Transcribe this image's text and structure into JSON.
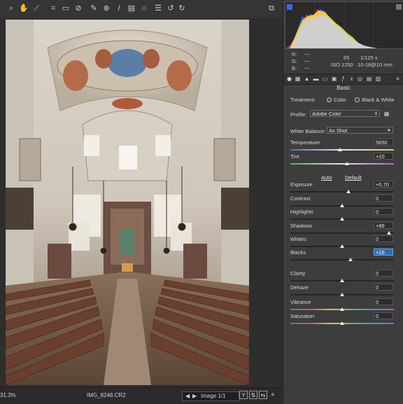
{
  "toolbar": {
    "icons": [
      "zoom-tool",
      "hand-tool",
      "white-balance-tool",
      "color-sampler-tool",
      "crop-tool",
      "straighten-tool",
      "spot-removal-tool",
      "red-eye-tool",
      "adjustment-brush",
      "graduated-filter",
      "radial-filter",
      "presets-list",
      "rotate-left",
      "rotate-right"
    ],
    "fullscreen_icon": "fullscreen-toggle"
  },
  "status": {
    "zoom": "31.3%",
    "filename": "IMG_8248.CR2",
    "image_counter": "Image 1/1",
    "prev_arrow": "◀",
    "next_arrow": "▶",
    "buttons": [
      "Y",
      "⇅",
      "⇆",
      "≡"
    ]
  },
  "info": {
    "r_label": "R:",
    "g_label": "G:",
    "b_label": "B:",
    "r_value": "---",
    "g_value": "---",
    "b_value": "---",
    "aperture": "f/5",
    "shutter": "1/125 s",
    "iso": "ISO 1250",
    "lens": "10-18@10 mm"
  },
  "panel": {
    "section": "Basic",
    "treatment_label": "Treatment:",
    "treatment_color": "Color",
    "treatment_bw": "Black & White",
    "profile_label": "Profile:",
    "profile_value": "Adobe Color",
    "wb_label": "White Balance:",
    "wb_value": "As Shot",
    "auto": "Auto",
    "default": "Default",
    "sliders": [
      {
        "key": "temperature",
        "label": "Temperature",
        "value": "5650",
        "pos": 0.48
      },
      {
        "key": "tint",
        "label": "Tint",
        "value": "+10",
        "pos": 0.55
      },
      {
        "key": "exposure",
        "label": "Exposure",
        "value": "+0.70",
        "pos": 0.56
      },
      {
        "key": "contrast",
        "label": "Contrast",
        "value": "0",
        "pos": 0.5
      },
      {
        "key": "highlights",
        "label": "Highlights",
        "value": "0",
        "pos": 0.5
      },
      {
        "key": "shadows",
        "label": "Shadows",
        "value": "+89",
        "pos": 0.95
      },
      {
        "key": "whites",
        "label": "Whites",
        "value": "0",
        "pos": 0.5
      },
      {
        "key": "blacks",
        "label": "Blacks",
        "value": "+16",
        "pos": 0.58
      },
      {
        "key": "clarity",
        "label": "Clarity",
        "value": "0",
        "pos": 0.5
      },
      {
        "key": "dehaze",
        "label": "Dehaze",
        "value": "0",
        "pos": 0.5
      },
      {
        "key": "vibrance",
        "label": "Vibrance",
        "value": "0",
        "pos": 0.5
      },
      {
        "key": "saturation",
        "label": "Saturation",
        "value": "0",
        "pos": 0.5
      }
    ]
  },
  "colors": {
    "accent": "#2f6db5",
    "panel_bg": "#3d3d3d",
    "stage_bg": "#2e2e2e"
  }
}
